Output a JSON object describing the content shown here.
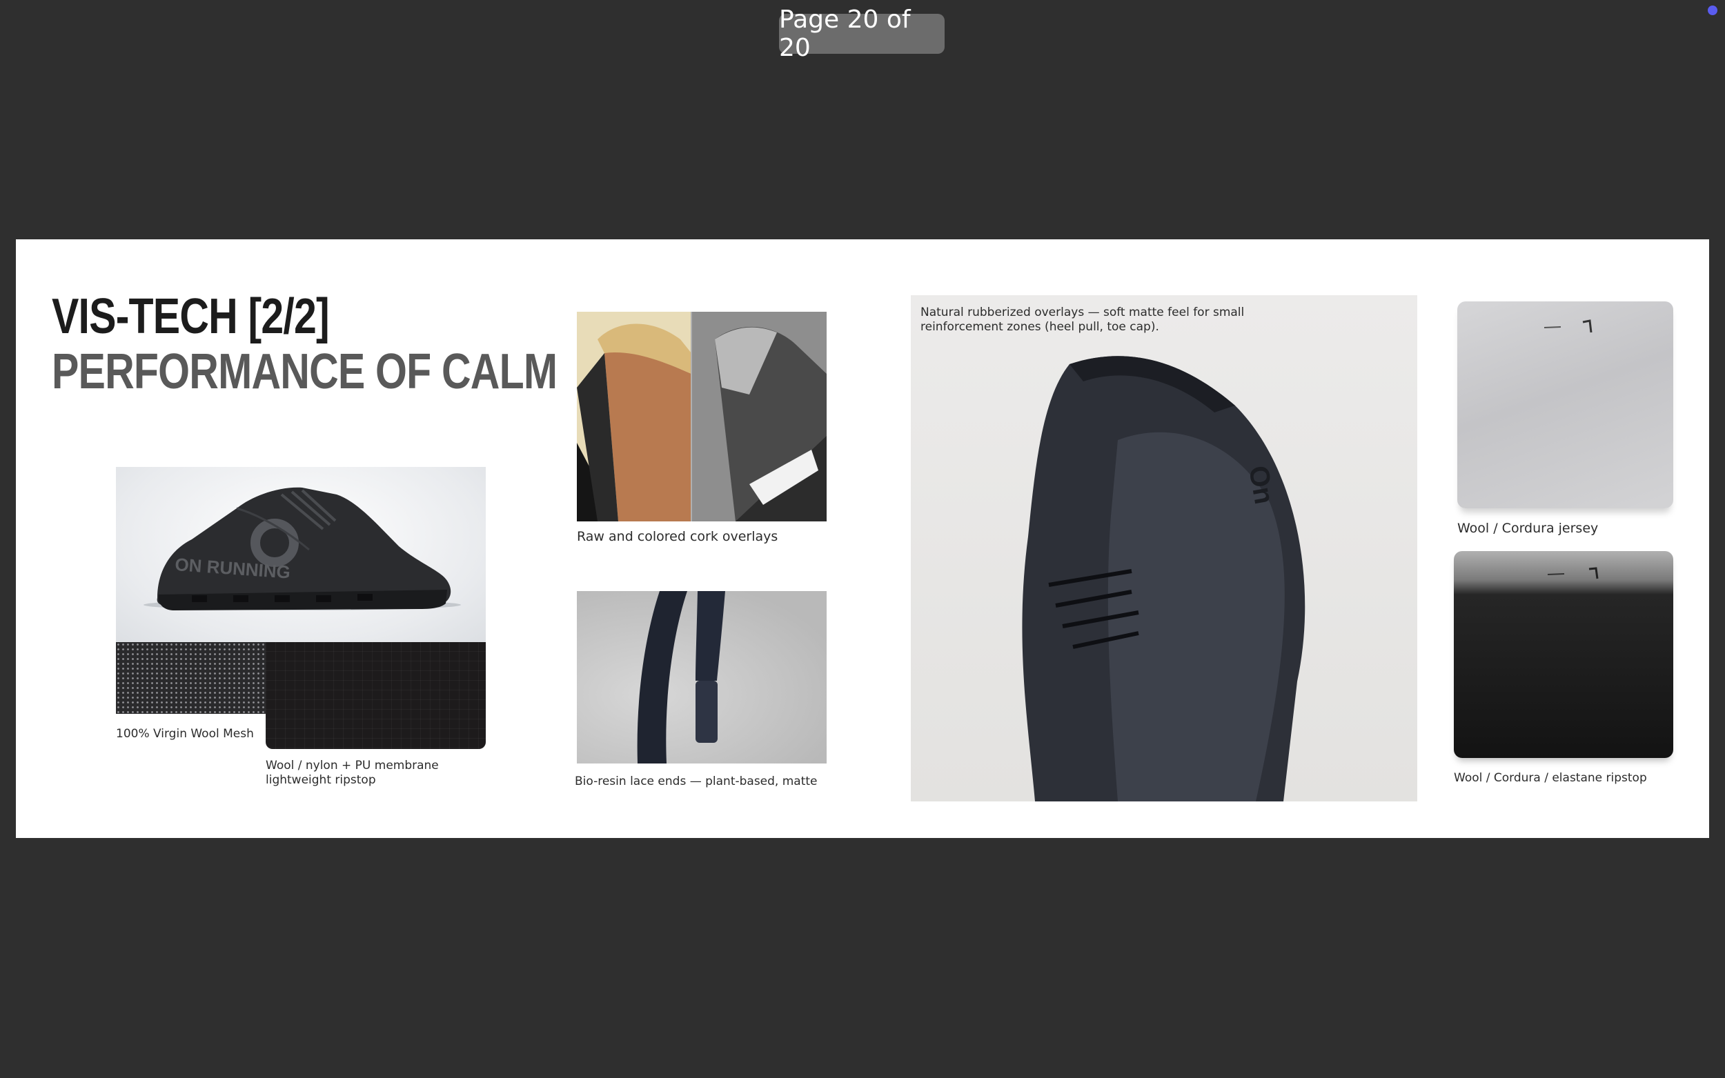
{
  "viewer": {
    "page_indicator": "Page 20 of 20",
    "status_dot_color": "#5a5cf0"
  },
  "slide": {
    "title_line_1": "VIS-TECH [2/2]",
    "title_line_2": "PERFORMANCE OF CALM",
    "captions": {
      "wool_mesh": "100% Virgin Wool Mesh",
      "membrane_line_1": "Wool / nylon + PU membrane",
      "membrane_line_2": "lightweight ripstop",
      "cork": "Raw and colored cork overlays",
      "lace": "Bio-resin lace ends — plant-based, matte",
      "rubber_line_1": "Natural rubberized overlays — soft matte feel for small",
      "rubber_line_2": "reinforcement zones (heel pull, toe cap).",
      "jersey": "Wool / Cordura jersey",
      "elastane": "Wool / Cordura / elastane ripstop"
    },
    "shoe_side_text": "ON RUNNING",
    "shoe_top_logo": "On"
  }
}
